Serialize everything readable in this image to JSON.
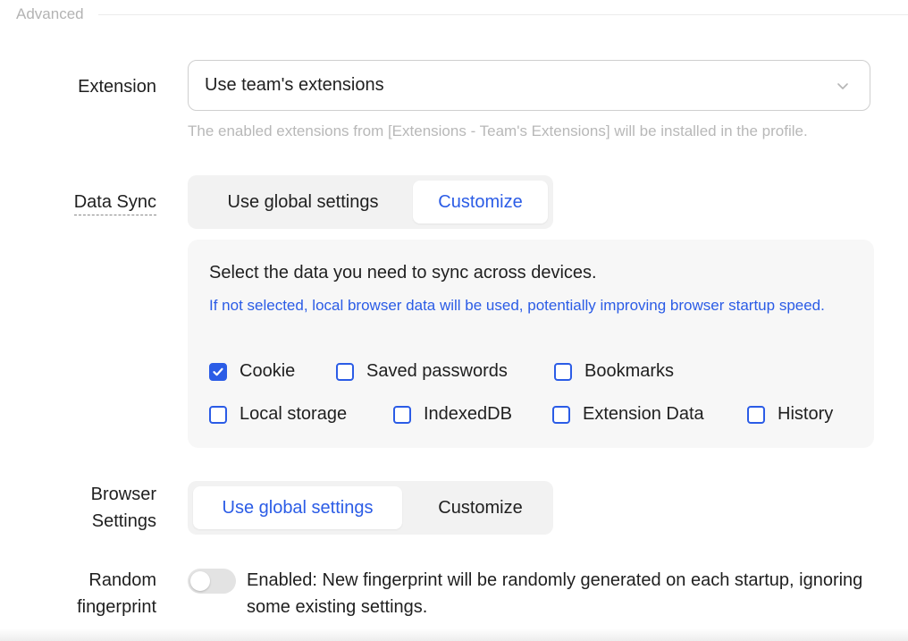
{
  "section": {
    "title": "Advanced"
  },
  "extension": {
    "label": "Extension",
    "selected": "Use team's extensions",
    "hint": "The enabled extensions from [Extensions - Team's Extensions] will be installed in the profile."
  },
  "data_sync": {
    "label": "Data Sync",
    "options": [
      "Use global settings",
      "Customize"
    ],
    "active_index": 1,
    "panel_title": "Select the data you need to sync across devices.",
    "panel_note": "If not selected, local browser data will be used, potentially improving browser startup speed.",
    "checkboxes": [
      {
        "label": "Cookie",
        "checked": true
      },
      {
        "label": "Saved passwords",
        "checked": false
      },
      {
        "label": "Bookmarks",
        "checked": false
      },
      {
        "label": "Local storage",
        "checked": false
      },
      {
        "label": "IndexedDB",
        "checked": false
      },
      {
        "label": "Extension Data",
        "checked": false
      },
      {
        "label": "History",
        "checked": false
      }
    ]
  },
  "browser_settings": {
    "label_line1": "Browser",
    "label_line2": "Settings",
    "options": [
      "Use global settings",
      "Customize"
    ],
    "active_index": 0
  },
  "random_fingerprint": {
    "label_line1": "Random",
    "label_line2": "fingerprint",
    "enabled": false,
    "description": "Enabled: New fingerprint will be randomly generated on each startup, ignoring some existing settings."
  },
  "colors": {
    "accent": "#2b5ce6",
    "muted": "#b8b8b8"
  }
}
